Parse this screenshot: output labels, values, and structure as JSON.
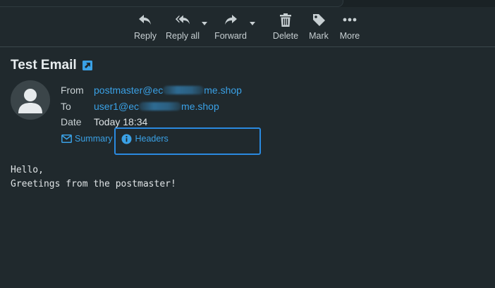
{
  "toolbar": {
    "reply_label": "Reply",
    "reply_all_label": "Reply all",
    "forward_label": "Forward",
    "delete_label": "Delete",
    "mark_label": "Mark",
    "more_label": "More"
  },
  "message": {
    "subject": "Test Email",
    "from_key": "From",
    "from_prefix": "postmaster@ec",
    "from_suffix": "me.shop",
    "to_key": "To",
    "to_prefix": "user1@ec",
    "to_suffix": "me.shop",
    "date_key": "Date",
    "date_value": "Today 18:34",
    "body": "Hello,\nGreetings from the postmaster!"
  },
  "view_tabs": {
    "summary_label": "Summary",
    "headers_label": "Headers"
  },
  "colors": {
    "background": "#20292d",
    "link": "#3aa1e6",
    "highlight": "#2a8ae0",
    "text": "#dfe4e6"
  },
  "icons": {
    "reply": "reply-icon",
    "reply_all": "reply-all-icon",
    "forward": "forward-icon",
    "delete": "trash-icon",
    "mark": "tag-icon",
    "more": "more-dots-icon",
    "popout": "popout-icon",
    "avatar": "user-avatar-icon",
    "summary": "envelope-icon",
    "headers": "info-icon"
  }
}
